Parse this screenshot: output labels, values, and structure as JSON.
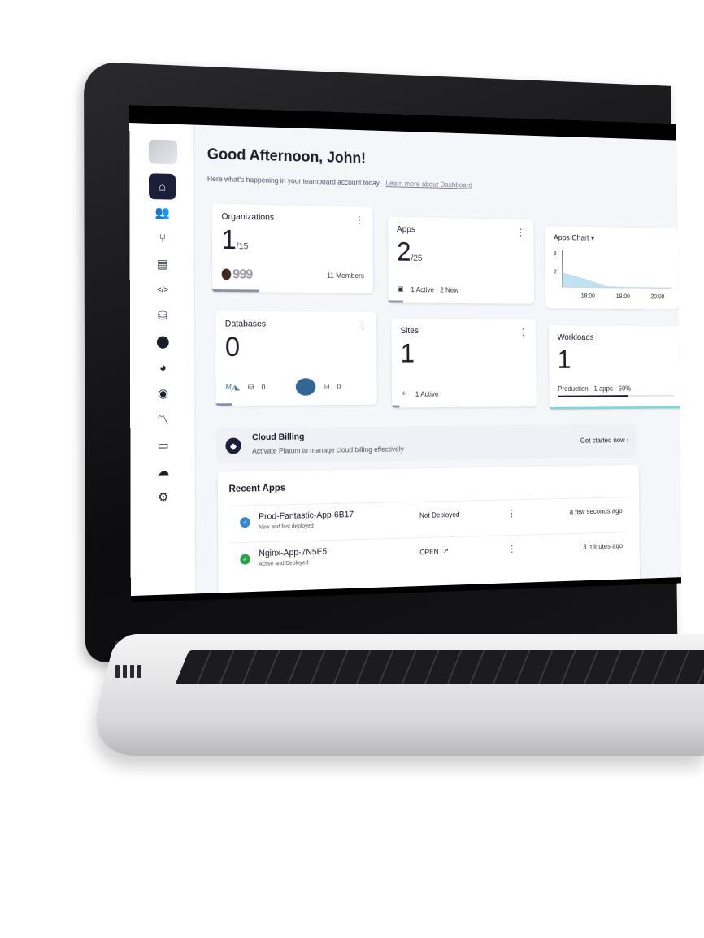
{
  "greeting": "Good Afternoon, John!",
  "subline": "Here what's happening in your teamboard account today.",
  "subline_link": "Learn more about Dashboard",
  "sidebar": {
    "items": [
      {
        "icon": "home-icon",
        "glyph": "⌂",
        "active": true
      },
      {
        "icon": "users-icon",
        "glyph": "👥"
      },
      {
        "icon": "branch-icon",
        "glyph": "⑂"
      },
      {
        "icon": "server-icon",
        "glyph": "▤"
      },
      {
        "icon": "code-icon",
        "glyph": "</>"
      },
      {
        "icon": "database-icon",
        "glyph": "⛁"
      },
      {
        "icon": "location-icon",
        "glyph": "⬤"
      },
      {
        "icon": "pie-icon",
        "glyph": "◕"
      },
      {
        "icon": "disk-icon",
        "glyph": "◉"
      },
      {
        "icon": "trend-icon",
        "glyph": "〽"
      },
      {
        "icon": "store-icon",
        "glyph": "▭"
      },
      {
        "icon": "cloud-icon",
        "glyph": "☁"
      },
      {
        "icon": "settings-icon",
        "glyph": "⚙"
      }
    ]
  },
  "cards": {
    "organizations": {
      "title": "Organizations",
      "value": "1",
      "total": "/15",
      "avatars": "999",
      "members": "11 Members"
    },
    "apps": {
      "title": "Apps",
      "value": "2",
      "total": "/25",
      "foot": "1 Active · 2 New"
    },
    "apps_chart": {
      "title": "Apps Chart",
      "caret": "▾"
    },
    "databases": {
      "title": "Databases",
      "value": "0",
      "mysql": "0",
      "postgres": "0"
    },
    "sites": {
      "title": "Sites",
      "value": "1",
      "foot": "1 Active"
    },
    "workloads": {
      "title": "Workloads",
      "value": "1",
      "foot": "Production · 1 apps · 60%"
    }
  },
  "chart_data": {
    "type": "area",
    "x": [
      "18:00",
      "19:00",
      "20:00"
    ],
    "yticks": [
      "8",
      "2"
    ],
    "series": [
      {
        "values": [
          2,
          1.2,
          0.2,
          0.1,
          0.1,
          0.1
        ]
      }
    ]
  },
  "billing": {
    "title": "Cloud Billing",
    "subtitle": "Activate Platum to manage cloud billing effectively",
    "cta": "Get started now"
  },
  "recent": {
    "title": "Recent Apps",
    "rows": [
      {
        "name": "Prod-Fantastic-App-6B17",
        "sub": "New and fast deployed",
        "status": "Not Deployed",
        "time": "a few seconds ago",
        "color": "#2f86d8",
        "glyph": "✓"
      },
      {
        "name": "Nginx-App-7N5E5",
        "sub": "Active and Deployed",
        "status": "OPEN",
        "time": "3 minutes ago",
        "color": "#2aa24a",
        "glyph": "✓"
      }
    ]
  }
}
